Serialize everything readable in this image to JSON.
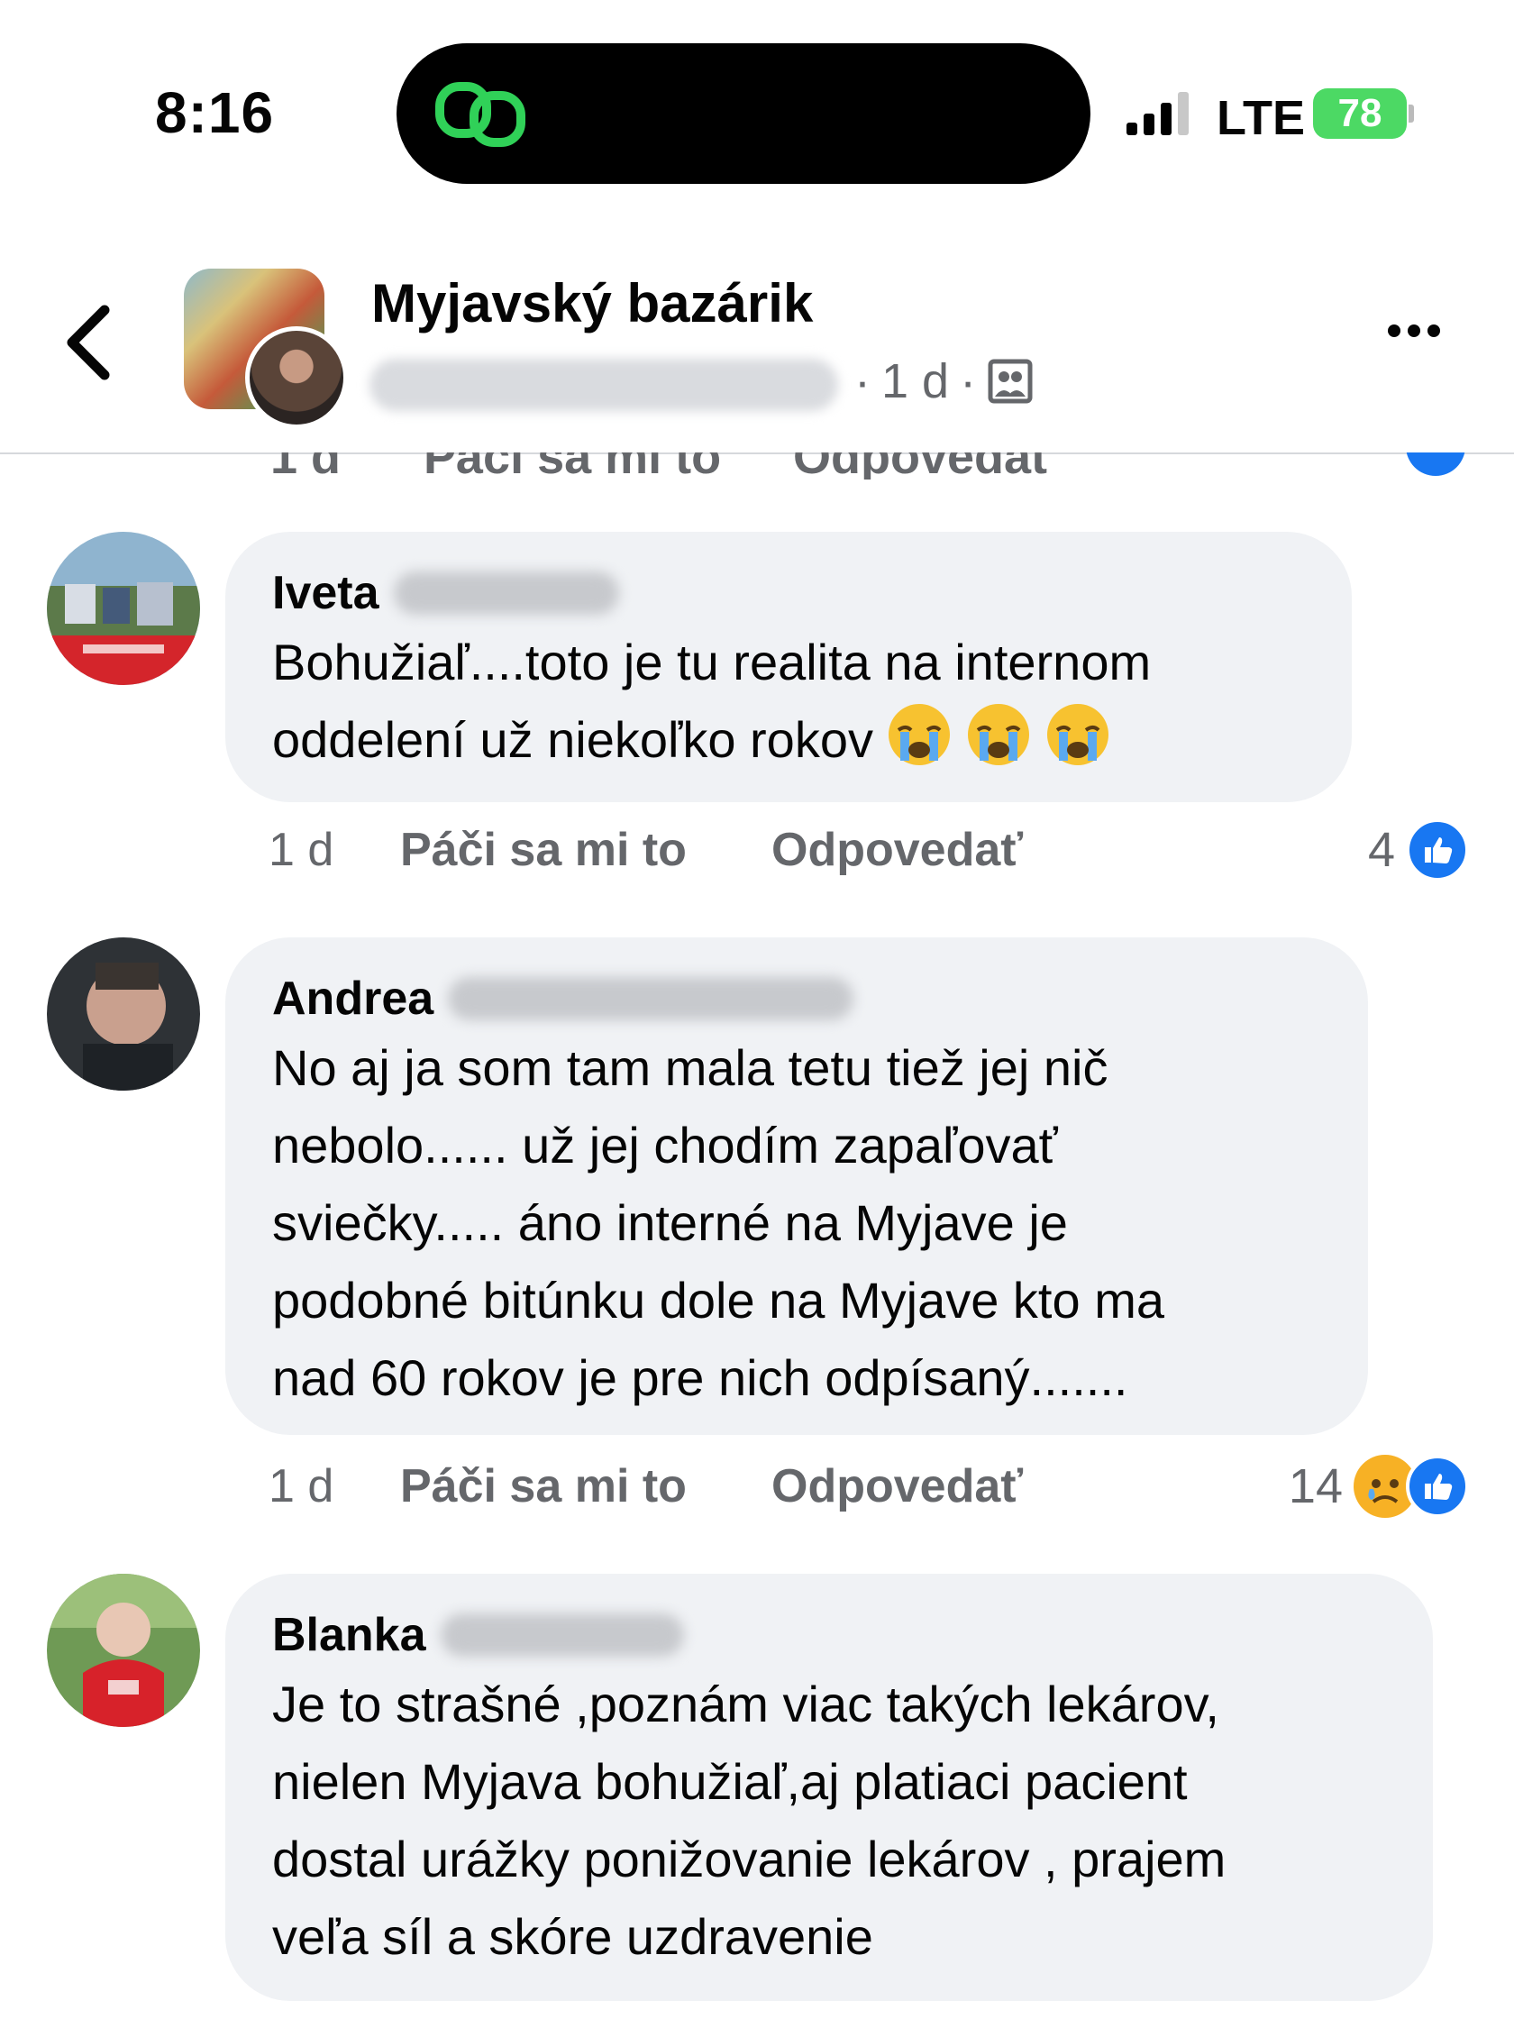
{
  "status_bar": {
    "time": "8:16",
    "network": "LTE",
    "battery": "78"
  },
  "header": {
    "group_name": "Myjavský bazárik",
    "post_age": "1 d",
    "separator": "·",
    "icons": {
      "back": "chevron-left-icon",
      "audience": "group-audience-icon",
      "more": "more-dots-icon"
    }
  },
  "comments": [
    {
      "author": "Iveta",
      "text": "Bohužiaľ....toto je tu realita na internom\noddelení už niekoľko rokov",
      "emoji": [
        "loudly-crying-face",
        "loudly-crying-face",
        "loudly-crying-face"
      ],
      "age": "1 d",
      "like_label": "Páči sa mi to",
      "reply_label": "Odpovedať",
      "reaction_count": "4",
      "reactions": [
        "like"
      ]
    },
    {
      "author": "Andrea",
      "text": "No aj ja som tam mala tetu tiež jej nič\nnebolo...... už jej chodím zapaľovať\nsviečky..... áno interné na Myjave je\npodobné bitúnku dole na Myjave kto ma\nnad 60 rokov je pre nich odpísaný.......",
      "emoji": [],
      "age": "1 d",
      "like_label": "Páči sa mi to",
      "reply_label": "Odpovedať",
      "reaction_count": "14",
      "reactions": [
        "sad",
        "like"
      ]
    },
    {
      "author": "Blanka",
      "text": "Je to strašné ,poznám viac takých lekárov,\nnielen Myjava bohužiaľ,aj platiaci pacient\ndostal urážky ponižovanie lekárov , prajem\nveľa síl a skóre uzdravenie",
      "emoji": []
    }
  ],
  "colors": {
    "accent": "#1877f2",
    "bubble": "#f0f2f5",
    "meta_text": "#65676b",
    "battery": "#4cd964"
  }
}
